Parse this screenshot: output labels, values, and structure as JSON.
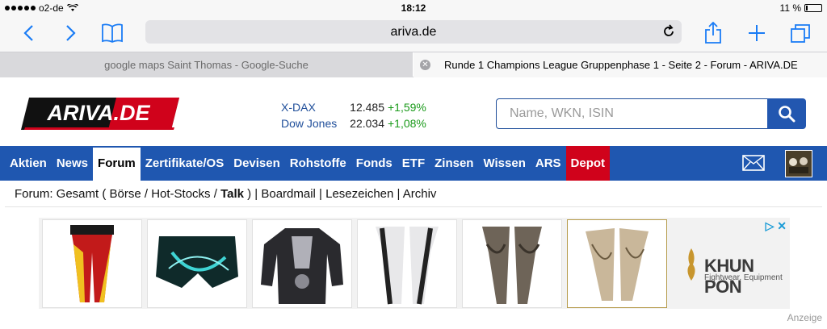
{
  "status": {
    "carrier": "o2-de",
    "time": "18:12",
    "battery": "11 %",
    "battery_level": 0.11
  },
  "browser": {
    "url": "ariva.de",
    "tabs": [
      {
        "label": "google maps Saint Thomas - Google-Suche"
      },
      {
        "label": "Runde 1 Champions League Gruppenphase 1 - Seite 2 - Forum - ARIVA.DE"
      }
    ]
  },
  "site": {
    "logo_text": "ARIVA.DE",
    "quotes": [
      {
        "name": "X-DAX",
        "value": "12.485",
        "change": "+1,59%"
      },
      {
        "name": "Dow Jones",
        "value": "22.034",
        "change": "+1,08%"
      }
    ],
    "search": {
      "placeholder": "Name, WKN, ISIN"
    },
    "nav": [
      {
        "label": "Aktien"
      },
      {
        "label": "News"
      },
      {
        "label": "Forum"
      },
      {
        "label": "Zertifikate/OS"
      },
      {
        "label": "Devisen"
      },
      {
        "label": "Rohstoffe"
      },
      {
        "label": "Fonds"
      },
      {
        "label": "ETF"
      },
      {
        "label": "Zinsen"
      },
      {
        "label": "Wissen"
      },
      {
        "label": "ARS"
      },
      {
        "label": "Depot"
      }
    ],
    "breadcrumb": {
      "prefix": "Forum: Gesamt ( Börse / Hot-Stocks / ",
      "current": "Talk",
      "suffix": " ) | Boardmail | Lesezeichen | Archiv"
    }
  },
  "ad": {
    "brand_name": "KHUN PON",
    "brand_tagline": "Fightwear. Equipment",
    "label": "Anzeige"
  },
  "colors": {
    "accent": "#1a7cf5",
    "nav_blue": "#1f57b0",
    "depot_red": "#d0021b",
    "positive": "#1a9a1a"
  }
}
